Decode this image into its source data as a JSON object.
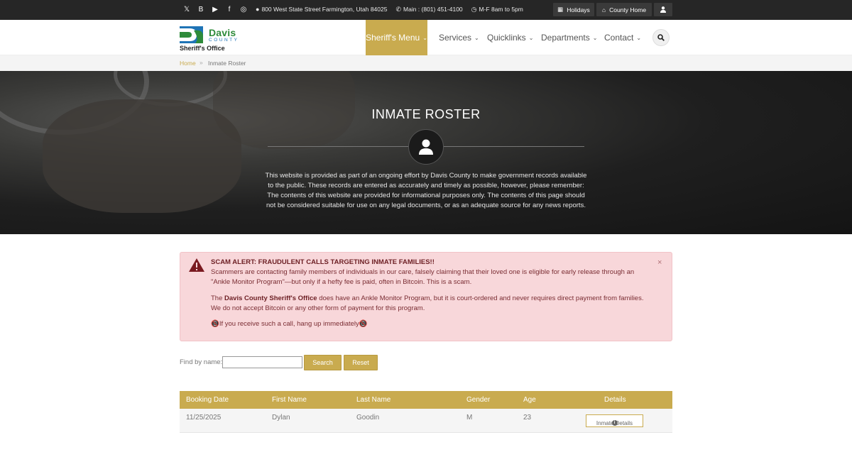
{
  "topbar": {
    "social": [
      {
        "icon": "twitter-icon",
        "glyph": "𝕏"
      },
      {
        "icon": "blogger-icon",
        "glyph": "B"
      },
      {
        "icon": "youtube-icon",
        "glyph": "▶"
      },
      {
        "icon": "facebook-icon",
        "glyph": "f"
      },
      {
        "icon": "instagram-icon",
        "glyph": "◎"
      }
    ],
    "address": "800 West State Street Farmington, Utah 84025",
    "phone": "Main : (801) 451-4100",
    "hours": "M-F 8am to 5pm",
    "holidays_label": "Holidays",
    "county_home_label": "County Home"
  },
  "logo": {
    "name": "Davis",
    "county": "COUNTY",
    "office": "Sheriff's Office"
  },
  "nav": {
    "items": [
      "Sheriff's Menu",
      "Services",
      "Quicklinks",
      "Departments",
      "Contact"
    ]
  },
  "breadcrumb": {
    "home": "Home",
    "separator": "»",
    "current": "Inmate Roster"
  },
  "hero": {
    "title": "INMATE ROSTER",
    "text": "This website is provided as part of an ongoing effort by Davis County to make government records available to the public. These records are entered as accurately and timely as possible, however, please remember: The contents of this website are provided for informational purposes only. The contents of this page should not be considered suitable for use on any legal documents, or as an adequate source for any news reports."
  },
  "alert": {
    "title": "SCAM ALERT: FRAUDULENT CALLS TARGETING INMATE FAMILIES!!",
    "p1": "Scammers are contacting family members of individuals in our care, falsely claiming that their loved one is eligible for early release through an \"Ankle Monitor Program\"—but only if a hefty fee is paid, often in Bitcoin. This is a scam.",
    "p2_pre": "The ",
    "p2_bold": "Davis County Sheriff's Office",
    "p2_post": " does have an Ankle Monitor Program, but it is court-ordered and never requires direct payment from families. We do not accept Bitcoin or any other form of payment for this program.",
    "p3": "📵If you receive such a call, hang up immediately📵",
    "close": "×"
  },
  "search": {
    "label": "Find by name:",
    "value": "",
    "search_label": "Search",
    "reset_label": "Reset"
  },
  "table": {
    "headers": [
      "Booking Date",
      "First Name",
      "Last Name",
      "Gender",
      "Age",
      "Details"
    ],
    "rows": [
      {
        "booking_date": "11/25/2025",
        "first_name": "Dylan",
        "last_name": "Goodin",
        "gender": "M",
        "age": "23",
        "details": "Inmate Details"
      }
    ]
  },
  "colors": {
    "gold": "#c9ab4f",
    "topbar": "#262626",
    "alert_bg": "#f8d7da"
  }
}
